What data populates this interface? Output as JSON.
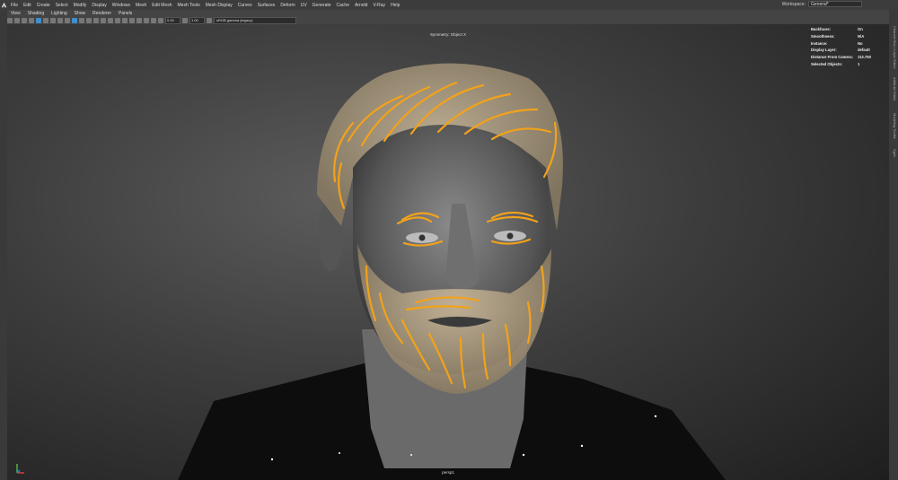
{
  "menubar": {
    "items": [
      "File",
      "Edit",
      "Create",
      "Select",
      "Modify",
      "Display",
      "Windows",
      "Mesh",
      "Edit Mesh",
      "Mesh Tools",
      "Mesh Display",
      "Curves",
      "Surfaces",
      "Deform",
      "UV",
      "Generate",
      "Cache",
      "Arnold",
      "V-Ray",
      "Help"
    ],
    "workspace_label": "Workspace:",
    "workspace_value": "General*"
  },
  "viewport_menu": [
    "View",
    "Shading",
    "Lighting",
    "Show",
    "Renderer",
    "Panels"
  ],
  "toolbar": {
    "exposure": "0.00",
    "gamma": "1.00",
    "colorspace": "sRGB gamma (legacy)"
  },
  "viewport": {
    "symmetry_title": "Symmetry: Object X",
    "camera_name": "persp1"
  },
  "hud": [
    {
      "label": "Backfaces:",
      "value": "On"
    },
    {
      "label": "Smoothness:",
      "value": "N/A"
    },
    {
      "label": "Instance:",
      "value": "No"
    },
    {
      "label": "Display Layer:",
      "value": "default"
    },
    {
      "label": "Distance From Camera:",
      "value": "113.750"
    },
    {
      "label": "Selected Objects:",
      "value": "1"
    }
  ],
  "side_tabs": [
    "Channel Box / Layer Editor",
    "Attribute Editor",
    "Modeling Toolkit",
    "Xgen"
  ],
  "colors": {
    "guide": "#f2a21a",
    "accent": "#3f8fd0"
  }
}
